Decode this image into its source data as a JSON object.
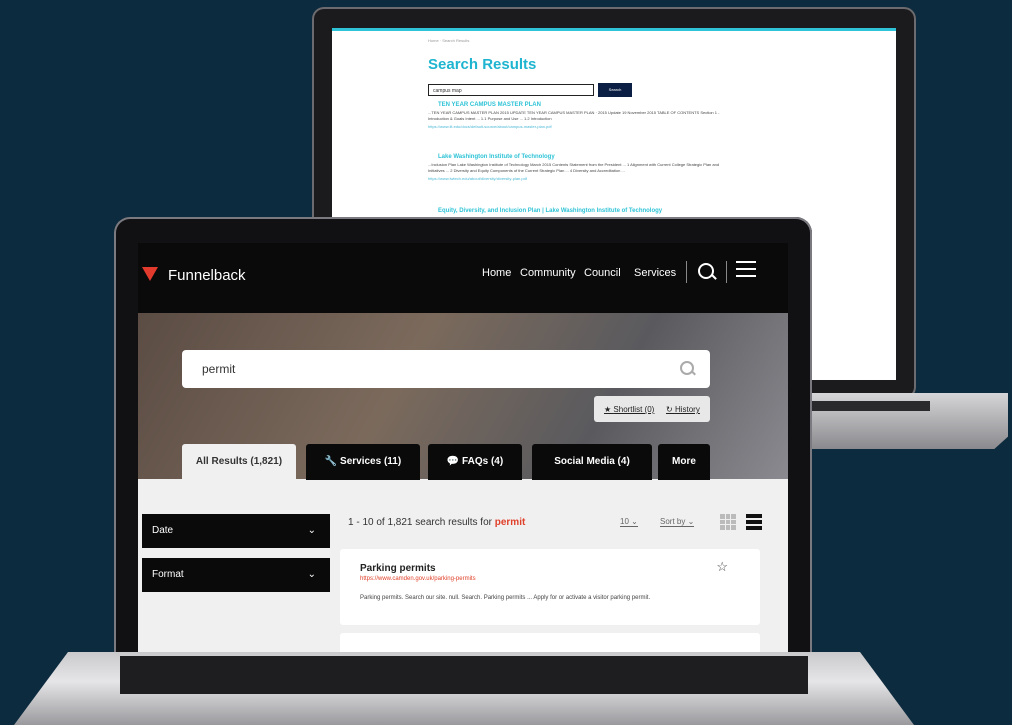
{
  "back_screen": {
    "breadcrumb": "Home  ·  Search Results",
    "title": "Search Results",
    "search_value": "campus map",
    "search_button": "Search",
    "results": [
      {
        "title": "TEN YEAR CAMPUS MASTER PLAN",
        "snippet": "...TEN YEAR CAMPUS MASTER PLAN 2015 UPDATE TEN YEAR CAMPUS MASTER PLAN · 2015 Update 19 November 2015 TABLE OF CONTENTS Section 1 - Introduction & Goals Intent ... 1.1 Purpose and Use ... 1.2 Introduction",
        "url": "https://www.lit.edu/docs/default-source/about/campus-master-plan.pdf"
      },
      {
        "title": "Lake Washington Institute of Technology",
        "snippet": "...Inclusion Plan Lake Washington Institute of Technology March 2015 Contents Statement from the President ... 1 Alignment with Current College Strategic Plan and Initiatives ... 2 Diversity and Equity Components of the Current Strategic Plan ... 4 Diversity and Accreditation ...",
        "url": "https://www.lwtech.edu/about/diversity/diversity-plan.pdf"
      },
      {
        "title": "Equity, Diversity, and Inclusion Plan | Lake Washington Institute of Technology",
        "snippet": "",
        "url": ""
      }
    ]
  },
  "front": {
    "brand": "Funnelback",
    "nav": [
      "Home",
      "Community",
      "Council",
      "Services"
    ],
    "search_value": "permit",
    "shortlist": "Shortlist (0)",
    "history": "History",
    "tabs": [
      "All Results (1,821)",
      "Services (11)",
      "FAQs (4)",
      "Social Media (4)",
      "More"
    ],
    "facets": [
      "Date",
      "Format"
    ],
    "results_prefix": "1 - 10 of 1,821 search results for",
    "results_query": "permit",
    "per_page": "10",
    "sort_by": "Sort by",
    "result": {
      "title": "Parking permits",
      "url": "https://www.camden.gov.uk/parking-permits",
      "snippet": "Parking permits. Search our site. null. Search. Parking permits ... Apply for or activate a visitor parking permit."
    }
  }
}
